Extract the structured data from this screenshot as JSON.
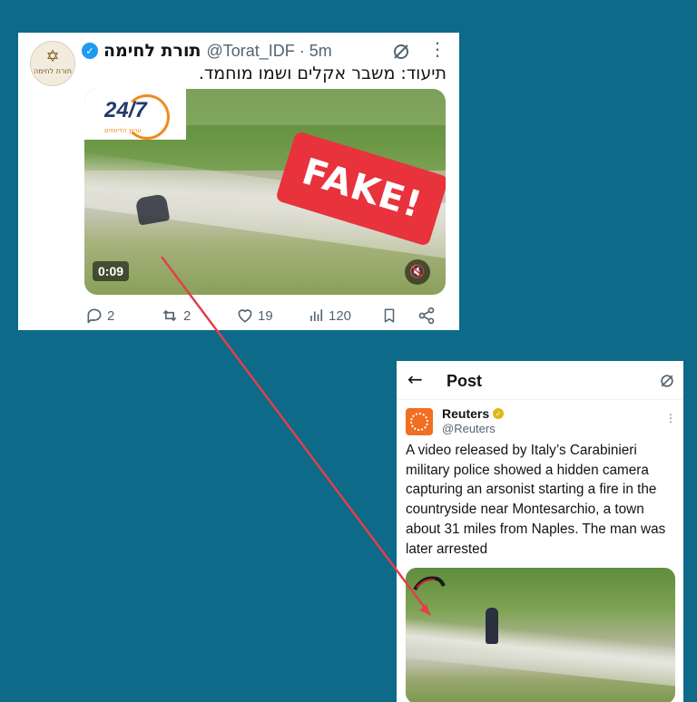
{
  "tweet": {
    "avatar_text": "תורת לחימה",
    "display_name": "תורת לחימה",
    "handle_time": "@Torat_IDF · 5m",
    "text": "תיעוד: משבר אקלים ושמו מוחמד.",
    "media": {
      "logo_text": "24/7",
      "logo_subtext": "ערוץ הדיווחים",
      "overlay_label": "FAKE!",
      "duration": "0:09"
    },
    "actions": {
      "replies": "2",
      "reposts": "2",
      "likes": "19",
      "views": "120"
    }
  },
  "post": {
    "header_title": "Post",
    "author_name": "Reuters",
    "author_handle": "@Reuters",
    "text": "A video released by Italy’s Carabinieri military police showed a hidden camera capturing an arsonist starting a fire in the countryside near Montesarchio, a town about 31 miles from Naples. The man was later arrested"
  },
  "colors": {
    "background": "#0d6a89",
    "fake_label": "#e8323c",
    "connector": "#e0404a",
    "verified_blue": "#1d9bf0",
    "verified_gold": "#e2b719",
    "reuters_orange": "#f26e21"
  },
  "icons": [
    "verified-badge-icon",
    "grok-icon",
    "more-icon",
    "mute-icon",
    "reply-icon",
    "repost-icon",
    "like-icon",
    "views-icon",
    "bookmark-icon",
    "share-icon",
    "back-arrow-icon"
  ]
}
